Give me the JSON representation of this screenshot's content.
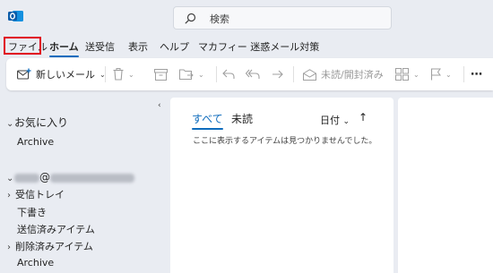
{
  "search": {
    "placeholder": "検索"
  },
  "menubar": {
    "items": [
      "ファイル",
      "ホーム",
      "送受信",
      "表示",
      "ヘルプ",
      "マカフィー 迷惑メール対策"
    ],
    "active": "ホーム",
    "highlighted": "ファイル"
  },
  "ribbon": {
    "new_mail": "新しいメール",
    "mark_read": "未読/開封済み",
    "more": "⋯"
  },
  "folders": {
    "favorites_header": "お気に入り",
    "favorites_items": [
      "Archive"
    ],
    "account_visible": "@",
    "account_items": [
      "受信トレイ",
      "下書き",
      "送信済みアイテム",
      "削除済みアイテム",
      "Archive"
    ]
  },
  "message_list": {
    "tabs": [
      "すべて",
      "未読"
    ],
    "sort_label": "日付",
    "sort_direction": "↑",
    "empty_text": "ここに表示するアイテムは見つかりませんでした。"
  },
  "colors": {
    "accent": "#0f6cbd",
    "highlight_box": "#e0001b",
    "background": "#e9ecf2"
  }
}
